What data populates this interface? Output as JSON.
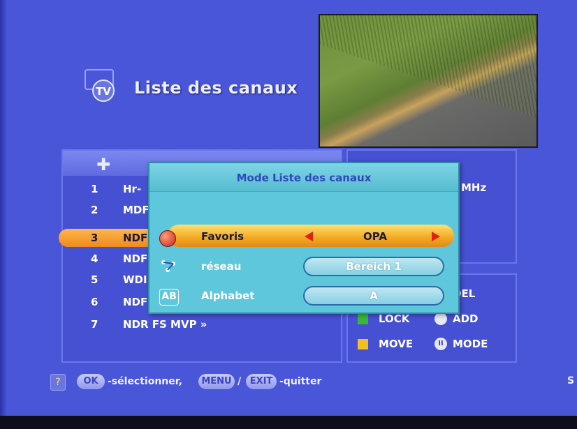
{
  "header": {
    "title": "Liste des canaux",
    "icon": "tv-icon"
  },
  "video": {
    "description_icon": "live-preview"
  },
  "channel_list": {
    "header_icon": "plus-icon",
    "channels": [
      {
        "num": "1",
        "name": "Hr-"
      },
      {
        "num": "2",
        "name": "MDF"
      },
      {
        "num": "3",
        "name": "NDF",
        "selected": true
      },
      {
        "num": "4",
        "name": "NDF"
      },
      {
        "num": "5",
        "name": "WDI"
      },
      {
        "num": "6",
        "name": "NDF"
      },
      {
        "num": "7",
        "name": "NDR FS MVP »"
      }
    ]
  },
  "info": {
    "mhz": "MHz"
  },
  "legend": {
    "items": [
      {
        "label": "DEL",
        "color": "#e6e8f2"
      },
      {
        "label": "LOCK",
        "color": "#38b838"
      },
      {
        "label": "ADD",
        "color": "#e6e8f2"
      },
      {
        "label": "MOVE",
        "color": "#f2c020"
      },
      {
        "label": "MODE",
        "color": "#e6e8f2"
      }
    ]
  },
  "dialog": {
    "title": "Mode Liste des canaux",
    "favoris": {
      "label": "Favoris",
      "value": "OPA",
      "icon": "heart-icon"
    },
    "reseau": {
      "label": "réseau",
      "value": "Bereich 1",
      "icon": "network-icon"
    },
    "alphabet": {
      "label": "Alphabet",
      "value": "A",
      "icon": "ab-icon",
      "icon_text": "AB"
    }
  },
  "help": {
    "ok": "OK",
    "select": "-sélectionner,",
    "menu": "MENU",
    "slash": "/",
    "exit": "EXIT",
    "quit": "-quitter",
    "edge": "S"
  },
  "colors": {
    "background": "#4a56d8",
    "selection": "#f5a030",
    "dialog": "#5ec7dc"
  }
}
